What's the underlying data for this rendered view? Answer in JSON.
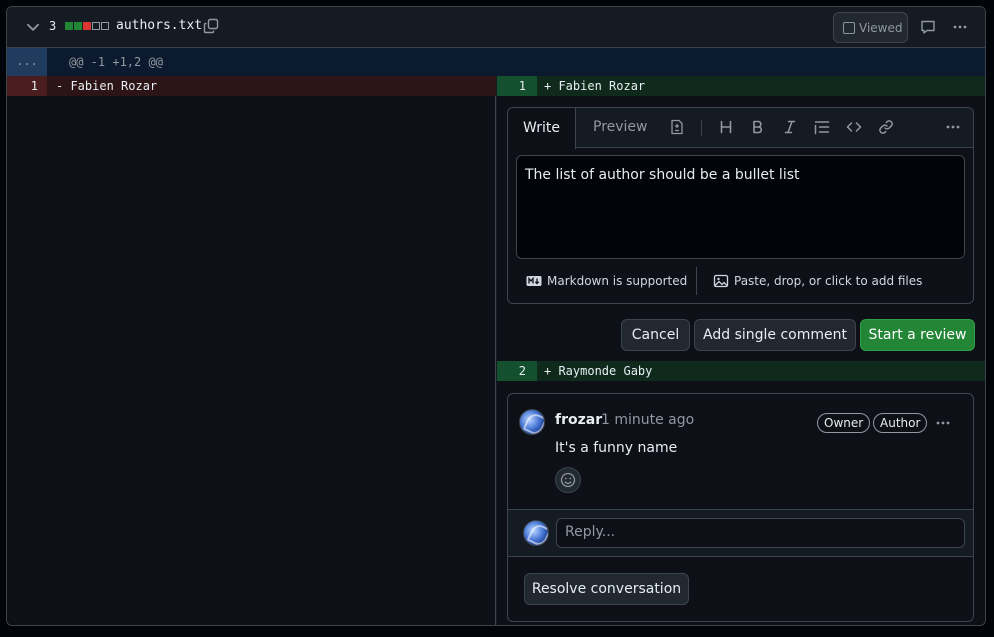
{
  "file": {
    "name": "authors.txt",
    "changes": "3",
    "diffstat_colors": [
      "#238636",
      "#238636",
      "#da3633",
      "#151b23",
      "#151b23"
    ],
    "viewed_label": "Viewed"
  },
  "hunk": {
    "expand": "...",
    "header": "@@ -1 +1,2 @@"
  },
  "left": {
    "lines": [
      {
        "num": "1",
        "code": "- Fabien Rozar"
      }
    ]
  },
  "right": {
    "lines": [
      {
        "num": "1",
        "code": "+ Fabien Rozar"
      },
      {
        "num": "2",
        "code": "+ Raymonde Gaby"
      }
    ]
  },
  "editor": {
    "tab_write": "Write",
    "tab_preview": "Preview",
    "text": "The list of author should be a bullet list",
    "markdown_note": "Markdown is supported",
    "attach_note": "Paste, drop, or click to add files"
  },
  "actions": {
    "cancel": "Cancel",
    "add_single": "Add single comment",
    "start_review": "Start a review"
  },
  "comment": {
    "author": "frozar",
    "time": "1 minute ago",
    "badges": [
      "Owner",
      "Author"
    ],
    "body": "It's a funny name",
    "reply_placeholder": "Reply...",
    "resolve": "Resolve conversation"
  }
}
